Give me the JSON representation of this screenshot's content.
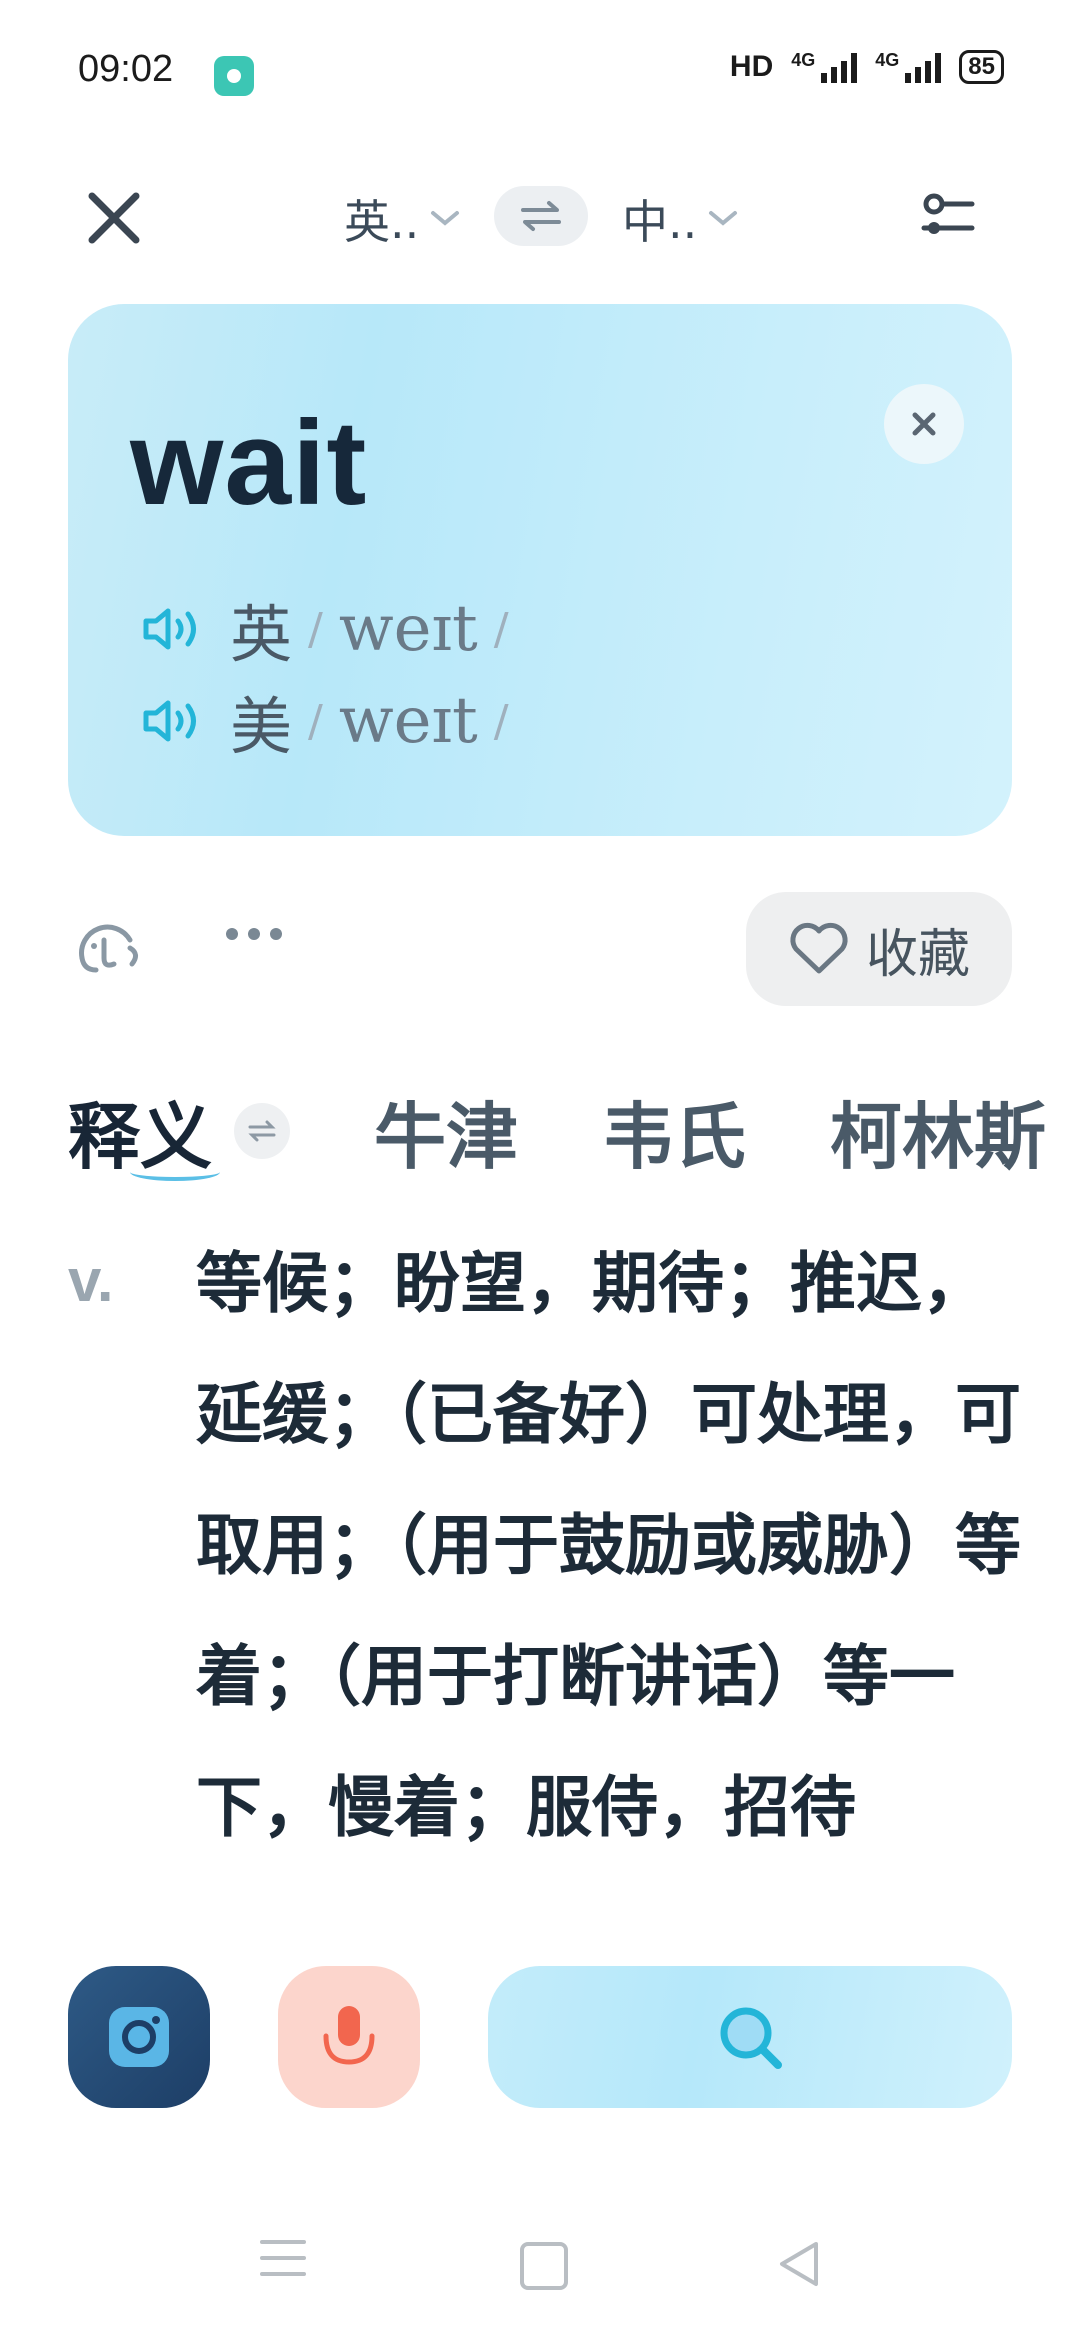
{
  "status_bar": {
    "time": "09:02",
    "hd": "HD",
    "net1": "4G",
    "net2": "4G",
    "battery": "85"
  },
  "top_bar": {
    "source_lang": "英..",
    "target_lang": "中..",
    "icons": [
      "close-icon",
      "swap-icon",
      "settings-icon",
      "chevron-down-icon"
    ]
  },
  "word_card": {
    "word": "wait",
    "pron_uk_label": "英",
    "pron_uk_ipa": "weɪt",
    "pron_us_label": "美",
    "pron_us_ipa": "weɪt",
    "slash": "/"
  },
  "actions": {
    "collect_label": "收藏"
  },
  "tabs": {
    "definition": "释义",
    "oxford": "牛津",
    "webster": "韦氏",
    "collins": "柯林斯"
  },
  "definition": {
    "pos": "v.",
    "text": "等候；盼望，期待；推迟，延缓；（已备好）可处理，可取用；（用于鼓励或威胁）等着；（用于打断讲话）等一下，慢着；服侍，招待"
  },
  "colors": {
    "accent": "#3ab8e6",
    "card_bg": "#c8ecf8",
    "camera_bg": "#1d3e66",
    "mic_bg": "#fcd5cc",
    "mic_accent": "#f2664e"
  }
}
